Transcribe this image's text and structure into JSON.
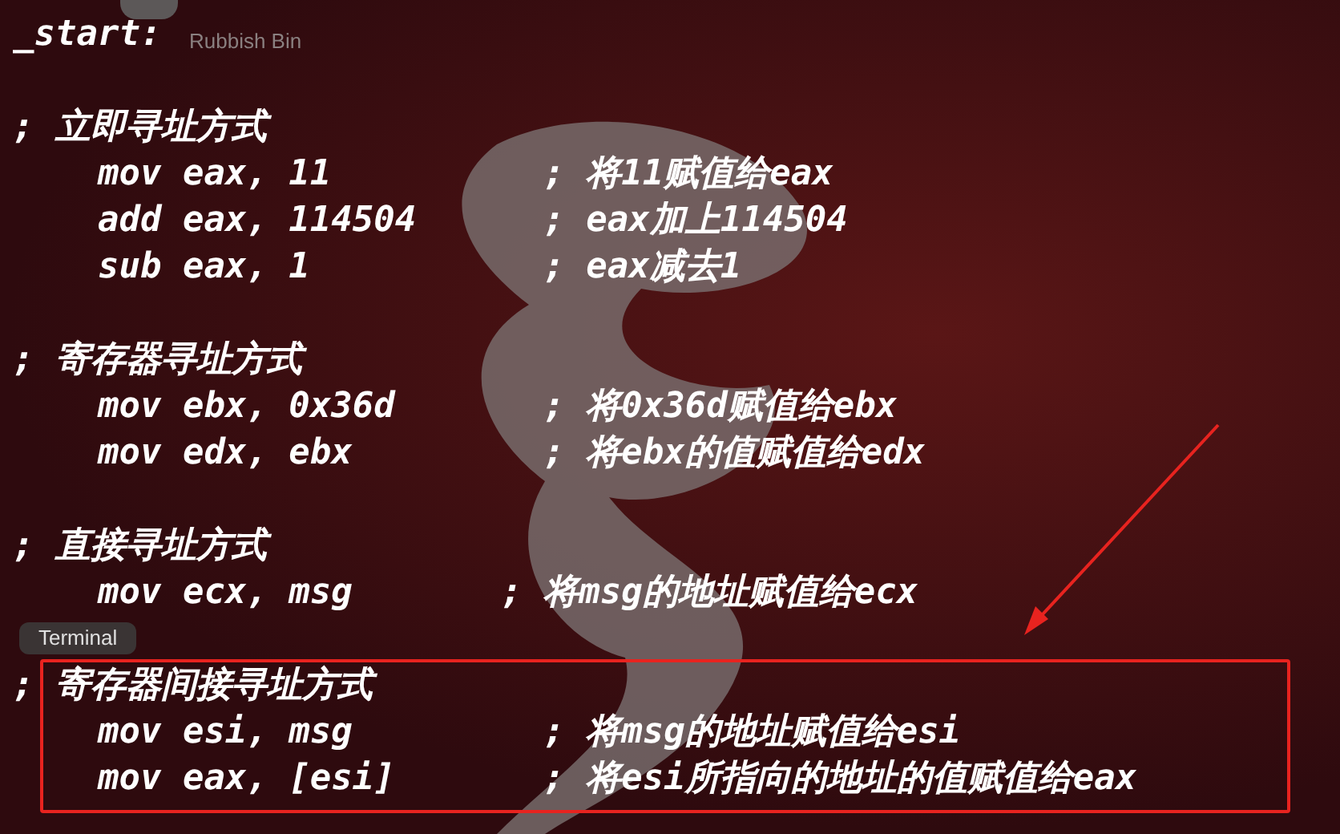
{
  "desktop": {
    "trash_label": "Rubbish Bin",
    "tooltip": "Terminal"
  },
  "lines": [
    {
      "kind": "label",
      "text": "_start:"
    },
    {
      "kind": "blank"
    },
    {
      "kind": "comment",
      "text": "; 立即寻址方式"
    },
    {
      "kind": "code",
      "text": "    mov eax, 11          ; 将11赋值给eax"
    },
    {
      "kind": "code",
      "text": "    add eax, 114504      ; eax加上114504"
    },
    {
      "kind": "code",
      "text": "    sub eax, 1           ; eax减去1"
    },
    {
      "kind": "blank"
    },
    {
      "kind": "comment",
      "text": "; 寄存器寻址方式"
    },
    {
      "kind": "code",
      "text": "    mov ebx, 0x36d       ; 将0x36d赋值给ebx"
    },
    {
      "kind": "code",
      "text": "    mov edx, ebx         ; 将ebx的值赋值给edx"
    },
    {
      "kind": "blank"
    },
    {
      "kind": "comment",
      "text": "; 直接寻址方式"
    },
    {
      "kind": "code",
      "text": "    mov ecx, msg       ; 将msg的地址赋值给ecx"
    },
    {
      "kind": "blank"
    },
    {
      "kind": "comment",
      "text": "; 寄存器间接寻址方式"
    },
    {
      "kind": "code",
      "text": "    mov esi, msg         ; 将msg的地址赋值给esi"
    },
    {
      "kind": "code",
      "text": "    mov eax, [esi]       ; 将esi所指向的地址的值赋值给eax"
    }
  ]
}
